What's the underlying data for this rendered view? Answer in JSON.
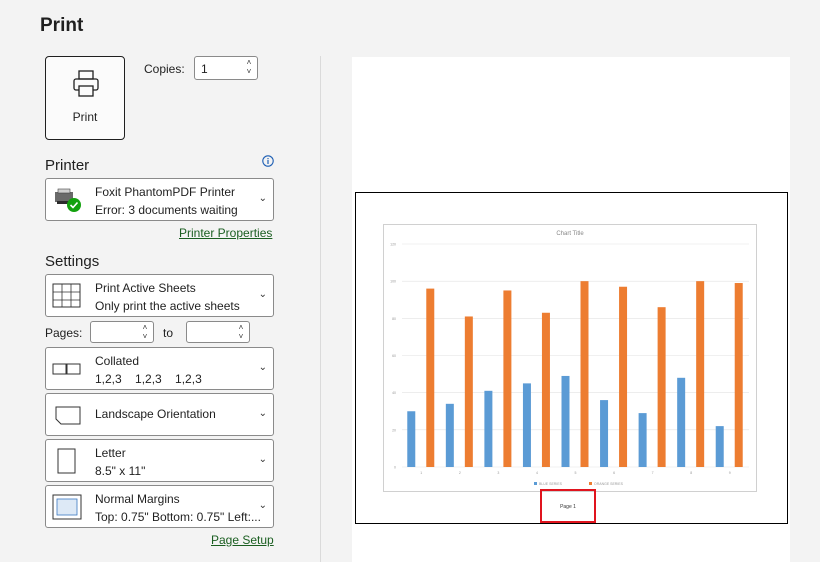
{
  "header": {
    "title": "Print"
  },
  "print_button": {
    "label": "Print"
  },
  "copies": {
    "label": "Copies:",
    "value": "1"
  },
  "printer": {
    "section_label": "Printer",
    "name": "Foxit PhantomPDF Printer",
    "status": "Error: 3 documents waiting",
    "properties_link": "Printer Properties"
  },
  "settings": {
    "section_label": "Settings",
    "active_sheets": {
      "title": "Print Active Sheets",
      "subtitle": "Only print the active sheets"
    },
    "pages": {
      "label": "Pages:",
      "from": "",
      "to_label": "to",
      "to": ""
    },
    "collated": {
      "title": "Collated",
      "subtitle": "1,2,3    1,2,3    1,2,3"
    },
    "orientation": {
      "title": "Landscape Orientation"
    },
    "paper": {
      "title": "Letter",
      "subtitle": "8.5\" x 11\""
    },
    "margins": {
      "title": "Normal Margins",
      "subtitle": "Top: 0.75\" Bottom: 0.75\" Left:..."
    },
    "page_setup_link": "Page Setup"
  },
  "preview": {
    "footer_text": "Page 1"
  },
  "colors": {
    "series1": "#5b9bd5",
    "series2": "#ed7d31",
    "highlight": "#e0141e",
    "link": "#1a5e20"
  },
  "chart_data": {
    "type": "bar",
    "title": "Chart Title",
    "categories": [
      "1",
      "2",
      "3",
      "4",
      "5",
      "6",
      "7",
      "8",
      "9"
    ],
    "series": [
      {
        "name": "BLUE SERIES",
        "values": [
          30,
          34,
          41,
          45,
          49,
          36,
          29,
          48,
          22
        ]
      },
      {
        "name": "ORANGE SERIES",
        "values": [
          96,
          81,
          95,
          83,
          100,
          97,
          86,
          100,
          99
        ]
      }
    ],
    "yticks": [
      "0",
      "20",
      "40",
      "60",
      "80",
      "100",
      "120"
    ],
    "ylim": [
      0,
      120
    ],
    "grid": true,
    "legend": "bottom"
  }
}
